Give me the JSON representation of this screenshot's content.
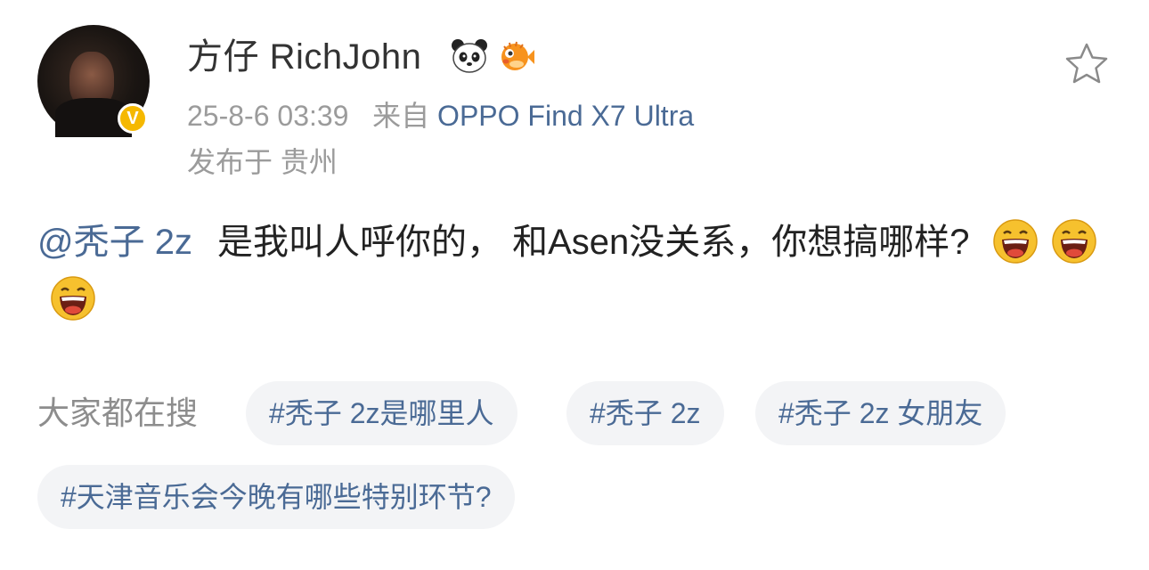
{
  "post": {
    "author": {
      "name": "方仔 RichJohn",
      "verified_mark": "V"
    },
    "badges": [
      "panda-badge-icon",
      "pufferfish-badge-icon"
    ],
    "timestamp": "25-8-6 03:39",
    "source_prefix": "来自",
    "source_device": "OPPO Find X7 Ultra",
    "location": "发布于 贵州",
    "mention": "@秃子 2z",
    "text": "是我叫人呼你的， 和Asen没关系，你想搞哪样?",
    "emojis": [
      "laughing-emoji-icon",
      "laughing-emoji-icon",
      "laughing-emoji-icon"
    ]
  },
  "search": {
    "label": "大家都在搜",
    "tags": [
      "#秃子 2z是哪里人",
      "#秃子 2z",
      "#秃子 2z 女朋友",
      "#天津音乐会今晚有哪些特别环节?"
    ]
  },
  "colors": {
    "link": "#4a6a95",
    "meta": "#9b9b9b",
    "badge": "#f5b800",
    "tag_bg": "#f3f4f6"
  }
}
